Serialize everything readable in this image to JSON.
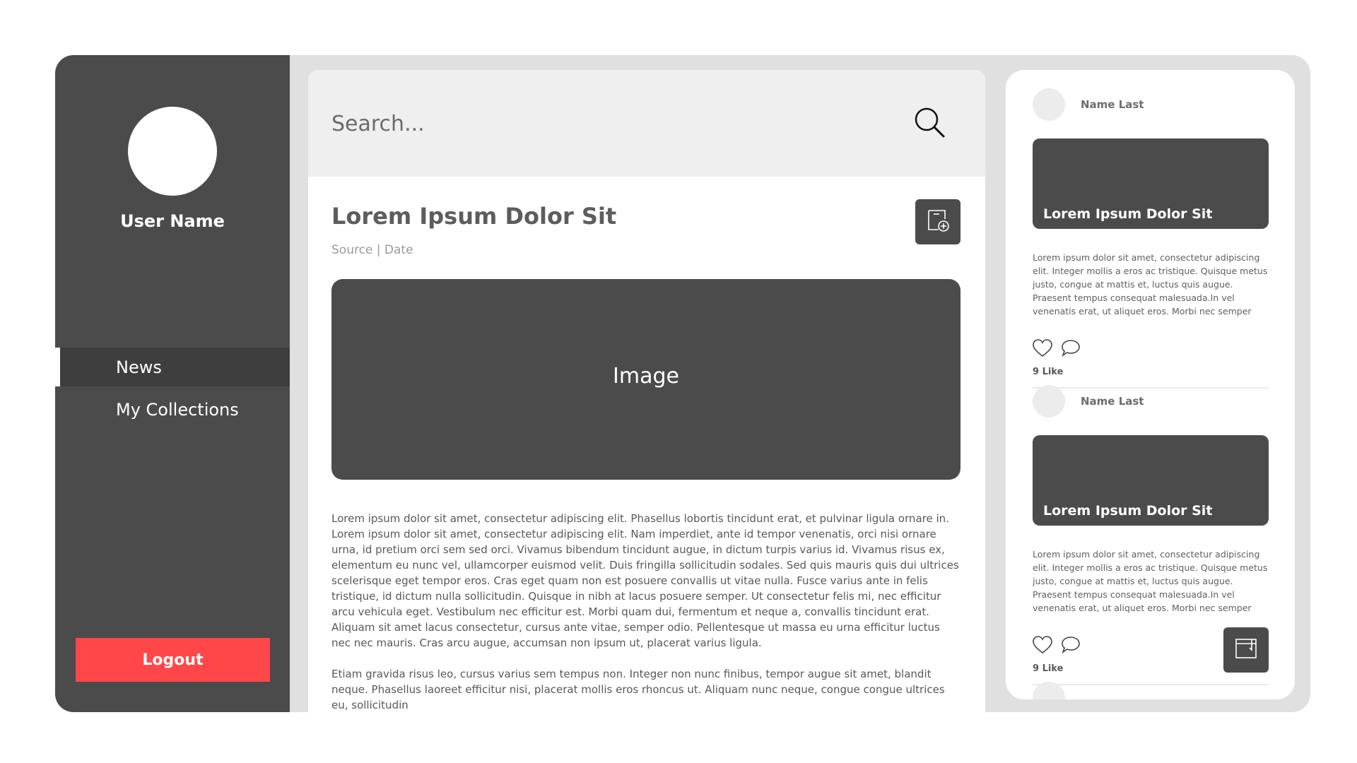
{
  "user": {
    "name": "User Name"
  },
  "nav": {
    "items": [
      {
        "label": "News",
        "active": true
      },
      {
        "label": "My Collections",
        "active": false
      }
    ]
  },
  "logout_label": "Logout",
  "search": {
    "placeholder": "Search..."
  },
  "article": {
    "title": "Lorem Ipsum Dolor Sit",
    "meta": "Source | Date",
    "image_label": "Image",
    "paragraphs": [
      "Lorem ipsum dolor sit amet, consectetur adipiscing elit. Phasellus lobortis tincidunt erat, et pulvinar ligula ornare in. Lorem ipsum dolor sit amet, consectetur adipiscing elit. Nam imperdiet, ante id tempor venenatis, orci nisi ornare urna, id pretium orci sem sed orci. Vivamus bibendum tincidunt augue, in dictum turpis varius id. Vivamus risus ex, elementum eu nunc vel, ullamcorper euismod velit. Duis fringilla sollicitudin sodales. Sed quis mauris quis dui ultrices scelerisque eget tempor eros. Cras eget quam non est posuere convallis ut vitae nulla. Fusce varius ante in felis tristique, id dictum nulla sollicitudin. Quisque in nibh at lacus posuere semper. Ut consectetur felis mi, nec efficitur arcu vehicula eget. Vestibulum nec efficitur est. Morbi quam dui, fermentum et neque a, convallis tincidunt erat. Aliquam sit amet lacus consectetur, cursus ante vitae, semper odio. Pellentesque ut massa eu urna efficitur luctus nec nec mauris. Cras arcu augue, accumsan non ipsum ut, placerat varius ligula.",
      "Etiam gravida risus leo, cursus varius sem tempus non. Integer non nunc finibus, tempor augue sit amet, blandit neque. Phasellus laoreet efficitur nisi, placerat mollis eros rhoncus ut. Aliquam nunc neque, congue congue ultrices eu, sollicitudin"
    ]
  },
  "feed": {
    "items": [
      {
        "author": "Name Last",
        "card_title": "Lorem Ipsum Dolor Sit",
        "text": "Lorem ipsum dolor sit amet, consectetur adipiscing elit. Integer mollis a eros ac tristique. Quisque metus justo, congue at mattis et, luctus quis augue. Praesent tempus consequat malesuada.In vel venenatis erat, ut aliquet eros. Morbi nec semper",
        "likes": "9 Like"
      },
      {
        "author": "Name Last",
        "card_title": "Lorem Ipsum Dolor Sit",
        "text": "Lorem ipsum dolor sit amet, consectetur adipiscing elit. Integer mollis a eros ac tristique. Quisque metus justo, congue at mattis et, luctus quis augue. Praesent tempus consequat malesuada.In vel venenatis erat, ut aliquet eros. Morbi nec semper",
        "likes": "9 Like"
      }
    ]
  },
  "icons": {
    "search": "search-icon",
    "collect": "add-to-collection-icon",
    "like": "heart-icon",
    "comment": "comment-icon",
    "note": "note-icon"
  },
  "colors": {
    "sidebar": "#4b4b4b",
    "logout": "#ff474a",
    "frame": "#e0e0e0",
    "search_bar": "#efefef"
  }
}
